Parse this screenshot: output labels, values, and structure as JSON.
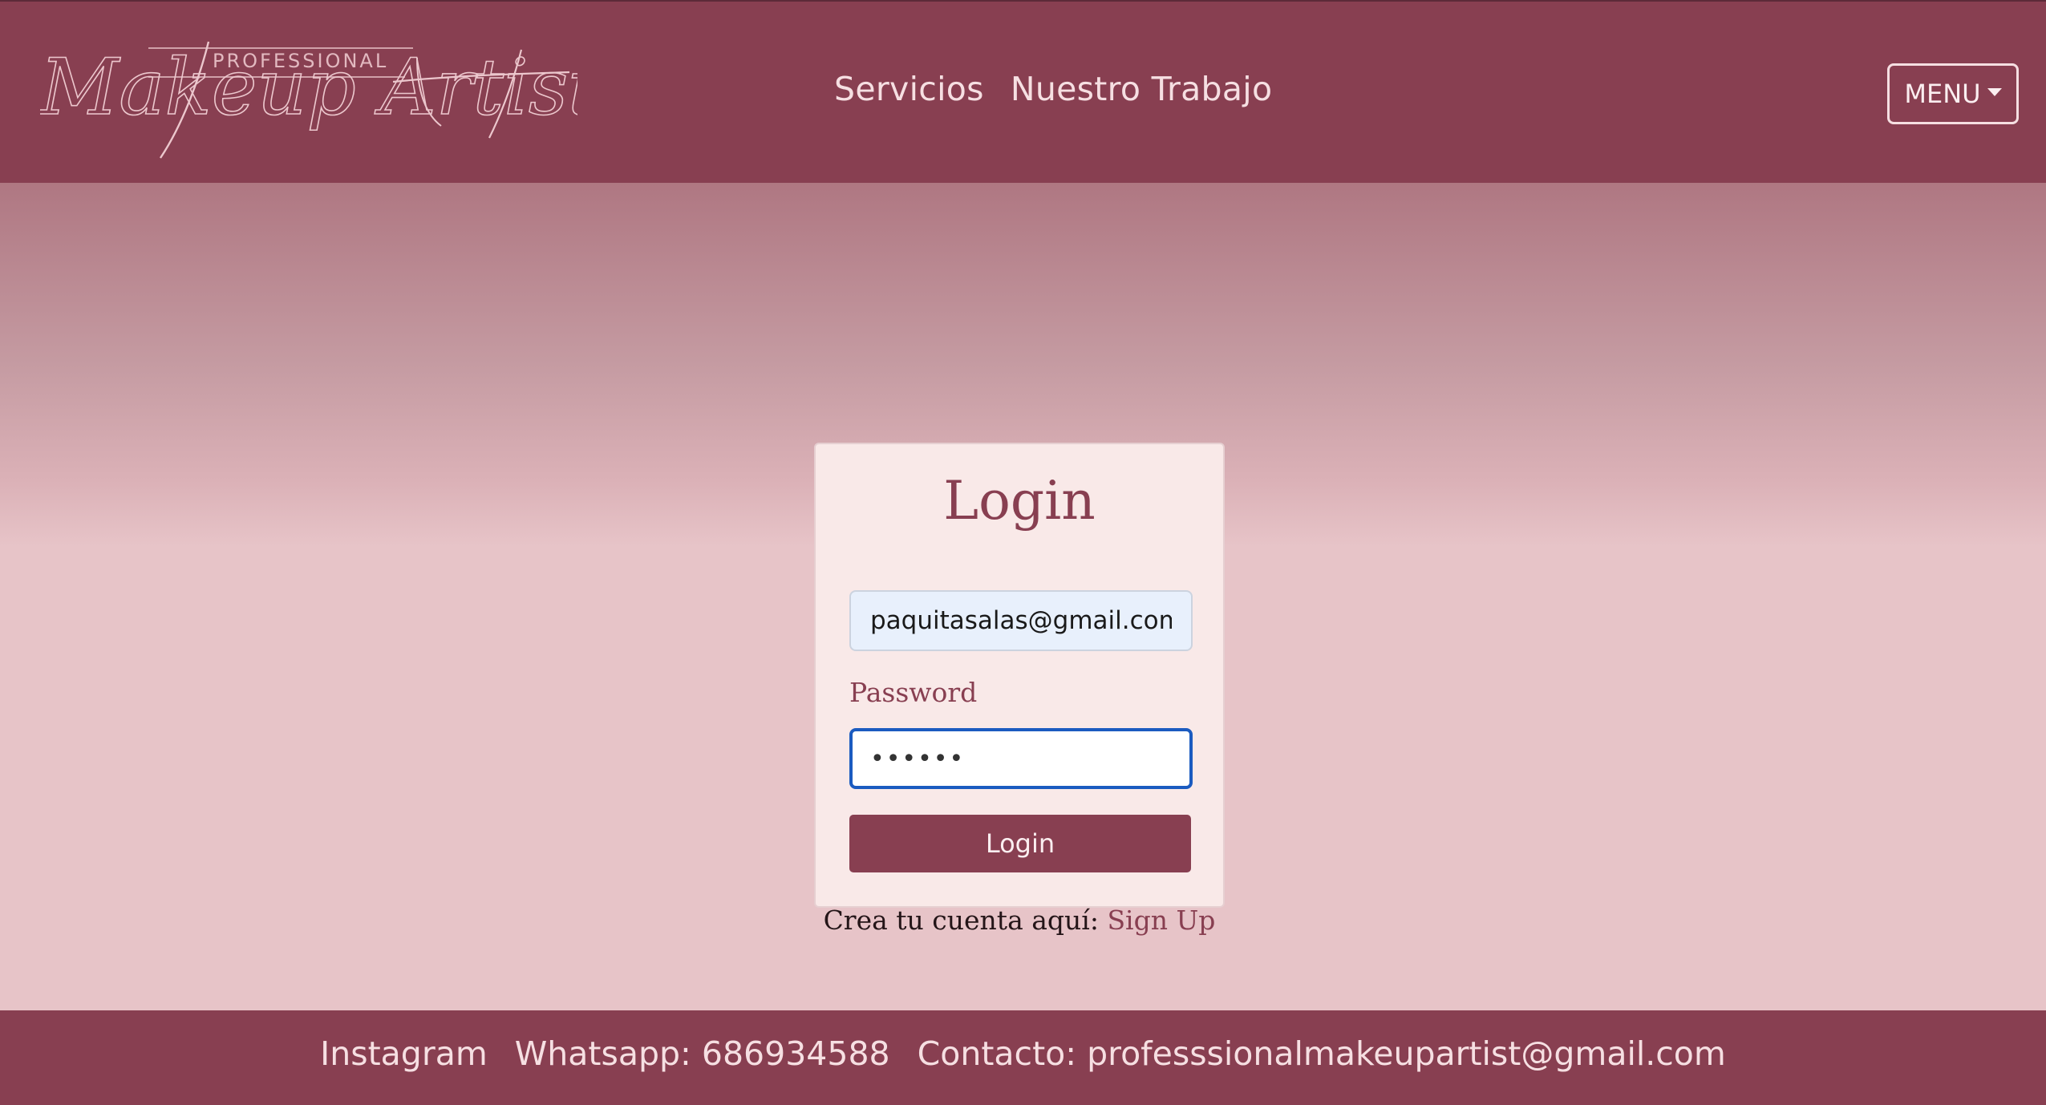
{
  "header": {
    "logo_small_text": "PROFESSIONAL",
    "logo_script_text": "Makeup Artist",
    "nav": [
      "Servicios",
      "Nuestro Trabajo"
    ],
    "menu_label": "MENU"
  },
  "login": {
    "title": "Login",
    "email_value": "paquitasalas@gmail.com",
    "password_label": "Password",
    "password_value": "••••••",
    "button_label": "Login",
    "signup_prompt": "Crea tu cuenta aquí: ",
    "signup_link": "Sign Up"
  },
  "footer": {
    "instagram": "Instagram",
    "whatsapp": "Whatsapp: 686934588",
    "contacto": "Contacto: professsionalmakeupartist@gmail.com"
  },
  "colors": {
    "brand": "#883f51",
    "background": "#e7c4c8",
    "card": "#f9e9e8",
    "focus": "#1b5bc0"
  }
}
